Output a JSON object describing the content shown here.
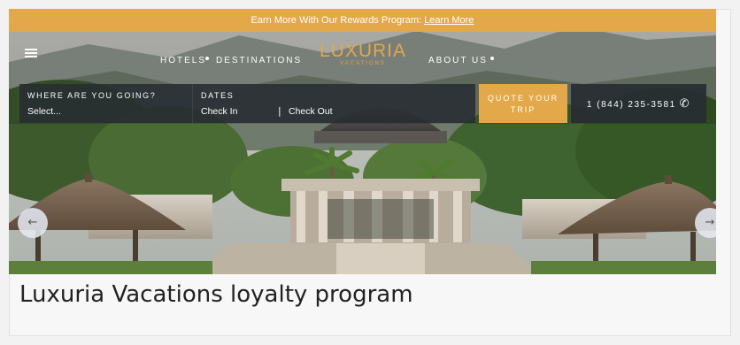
{
  "promo_bar": {
    "text": "Earn More With Our Rewards Program: ",
    "link": "Learn More"
  },
  "nav": {
    "hotels": "HOTELS",
    "destinations": "DESTINATIONS",
    "about": "ABOUT US"
  },
  "logo": {
    "name": "LUXURIA",
    "tagline": "VACATIONS"
  },
  "search": {
    "where_label": "WHERE ARE YOU GOING?",
    "where_value": "Select...",
    "dates_label": "DATES",
    "check_in": "Check In",
    "separator": "|",
    "check_out": "Check Out"
  },
  "quote_button": {
    "line1": "QUOTE YOUR",
    "line2": "TRIP"
  },
  "phone": "1 (844) 235-3581",
  "carousel": {
    "prev": "←",
    "next": "→"
  },
  "caption": "Luxuria Vacations loyalty program",
  "colors": {
    "accent": "#e3a84a",
    "search_bg": "#282c32"
  },
  "icons": {
    "menu": "hamburger-icon",
    "phone": "phone-icon",
    "prev": "arrow-left-icon",
    "next": "arrow-right-icon"
  }
}
